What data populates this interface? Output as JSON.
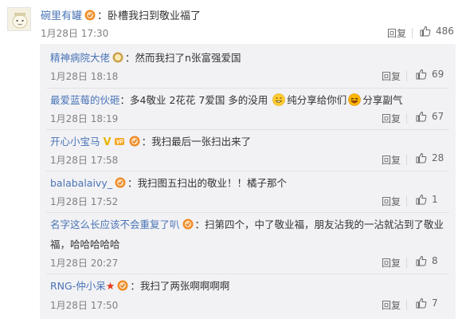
{
  "main_comment": {
    "username": "碗里有罐",
    "separator": "：",
    "text": "卧槽我扫到敬业福了",
    "time": "1月28日 17:30",
    "reply_label": "回复",
    "likes": "486"
  },
  "replies": [
    {
      "username": "精神病院大佬",
      "text": "然而我扫了n张富强爱国",
      "time": "1月28日 18:18",
      "reply_label": "回复",
      "likes": "69"
    },
    {
      "username": "最爱蓝莓的伙砸",
      "text_part1": "多4敬业 2花花 7爱国 多的没用 ",
      "text_part2": "纯分享给你们",
      "text_part3": "分享副气",
      "time": "1月28日 18:19",
      "reply_label": "回复",
      "likes": "67"
    },
    {
      "username": "开心小宝马",
      "v_mark": "V",
      "text": "我扫最后一张扫出来了",
      "time": "1月28日 17:58",
      "reply_label": "回复",
      "likes": "28"
    },
    {
      "username": "balabalaivy_",
      "text": "我扫图五扫出的敬业！！橘子那个",
      "time": "1月28日 17:52",
      "reply_label": "回复",
      "likes": "1"
    },
    {
      "username": "名字这么长应该不会重复了叭",
      "text_line1": "扫第四个，中了敬业福，朋友沾我的一沾就沾到了敬业",
      "text_line2": "福，哈哈哈哈哈",
      "time": "1月28日 20:27",
      "reply_label": "回复",
      "likes": "8"
    },
    {
      "username": "RNG-仲小呆",
      "star": "★",
      "text": "我扫了两张啊啊啊啊",
      "time": "1月28日 17:50",
      "reply_label": "回复",
      "likes": "7"
    }
  ],
  "colors": {
    "username": "#4a74b5",
    "text": "#333333",
    "meta": "#808080",
    "reply_panel_bg": "#f2f2f5",
    "verified_badge": "#f08a24",
    "star": "#e23b1c"
  },
  "icons": {
    "like": "thumbs-up-icon",
    "verified": "verified-badge-icon",
    "grin_emoji": "grin-emoji",
    "laugh_emoji": "laugh-emoji"
  }
}
